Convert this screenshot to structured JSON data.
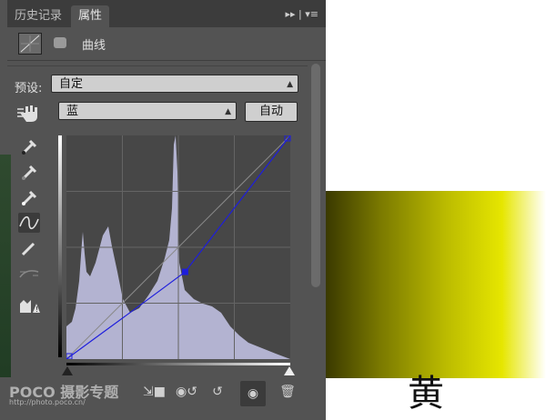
{
  "tabs": [
    {
      "label": "历史记录"
    },
    {
      "label": "属性"
    }
  ],
  "tab_controls": "▸▸ | ▾≡",
  "properties": {
    "title": "曲线"
  },
  "preset": {
    "label": "预设:",
    "value": "自定"
  },
  "channel": {
    "value": "蓝",
    "auto_label": "自动"
  },
  "watermark": {
    "logo": "POCO 摄影专题",
    "url": "http://photo.poco.cn/"
  },
  "canvas_text": "黄",
  "colors": {
    "panel": "#535353",
    "curve": "#1e1edc",
    "histogram": "#b3b3d1"
  },
  "icons": [
    "curves-icon",
    "mask-icon",
    "hand-tool-icon",
    "eyedropper-black-icon",
    "eyedropper-gray-icon",
    "eyedropper-white-icon",
    "curve-tool-icon",
    "pencil-icon",
    "smooth-icon",
    "clipping-warning-icon",
    "clip-to-layer-icon",
    "view-previous-icon",
    "reset-icon",
    "visibility-icon",
    "trash-icon"
  ],
  "curve_points": [
    [
      0,
      0
    ],
    [
      0.53,
      0.39
    ],
    [
      1,
      1
    ]
  ]
}
